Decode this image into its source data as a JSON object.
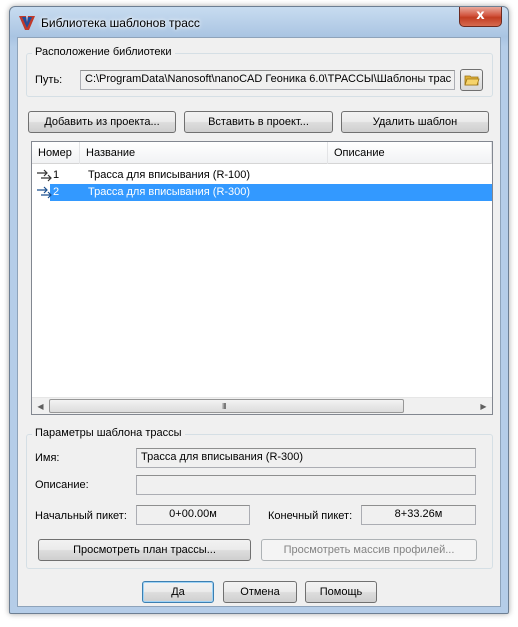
{
  "window": {
    "title": "Библиотека шаблонов трасс",
    "close_glyph": "x"
  },
  "location_group": {
    "title": "Расположение библиотеки",
    "path_label": "Путь:",
    "path_value": "C:\\ProgramData\\Nanosoft\\nanoCAD Геоника 6.0\\ТРАССЫ\\Шаблоны трас"
  },
  "toolbar": {
    "add_label": "Добавить из проекта...",
    "insert_label": "Вставить в проект...",
    "delete_label": "Удалить шаблон"
  },
  "list": {
    "columns": [
      "Номер",
      "Название",
      "Описание"
    ],
    "rows": [
      {
        "number": "1",
        "name": "Трасса для вписывания (R-100)",
        "description": "",
        "selected": false
      },
      {
        "number": "2",
        "name": "Трасса для вписывания (R-300)",
        "description": "",
        "selected": true
      }
    ],
    "scroll_grip": "III"
  },
  "params_group": {
    "title": "Параметры шаблона трассы",
    "name_label": "Имя:",
    "name_value": "Трасса для вписывания (R-300)",
    "description_label": "Описание:",
    "description_value": "",
    "start_label": "Начальный пикет:",
    "start_value": "0+00.00м",
    "end_label": "Конечный пикет:",
    "end_value": "8+33.26м",
    "view_plan_label": "Просмотреть план трассы...",
    "view_profiles_label": "Просмотреть массив профилей..."
  },
  "footer": {
    "ok_label": "Да",
    "cancel_label": "Отмена",
    "help_label": "Помощь"
  },
  "colors": {
    "selection": "#3399ff",
    "close_button": "#c23d22"
  },
  "icons": [
    "app-icon",
    "close-icon",
    "folder-icon",
    "route-icon",
    "scroll-left-icon",
    "scroll-right-icon"
  ]
}
